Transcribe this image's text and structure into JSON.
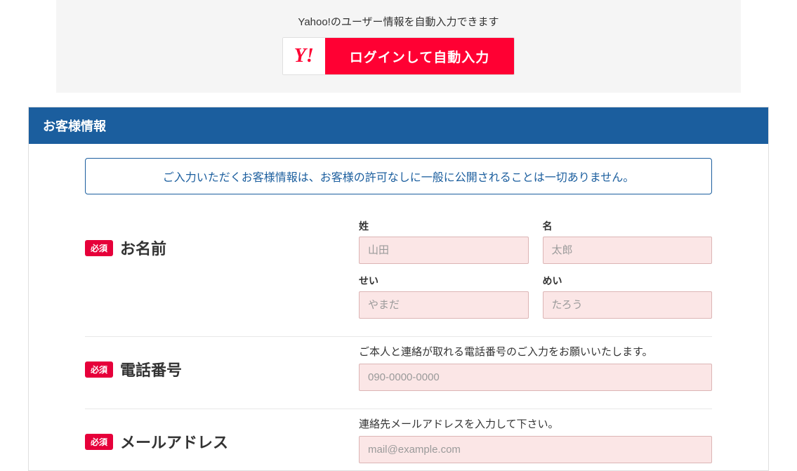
{
  "yahoo": {
    "info_text": "Yahoo!のユーザー情報を自動入力できます",
    "logo": "Y!",
    "login_button": "ログインして自動入力"
  },
  "form": {
    "header": "お客様情報",
    "notice": "ご入力いただくお客様情報は、お客様の許可なしに一般に公開されることは一切ありません。",
    "required_badge": "必須",
    "fields": {
      "name": {
        "label": "お名前",
        "last_name": {
          "sub_label": "姓",
          "placeholder": "山田"
        },
        "first_name": {
          "sub_label": "名",
          "placeholder": "太郎"
        },
        "last_kana": {
          "sub_label": "せい",
          "placeholder": "やまだ"
        },
        "first_kana": {
          "sub_label": "めい",
          "placeholder": "たろう"
        }
      },
      "phone": {
        "label": "電話番号",
        "help": "ご本人と連絡が取れる電話番号のご入力をお願いいたします。",
        "placeholder": "090-0000-0000"
      },
      "email": {
        "label": "メールアドレス",
        "help": "連絡先メールアドレスを入力して下さい。",
        "placeholder": "mail@example.com"
      }
    }
  }
}
